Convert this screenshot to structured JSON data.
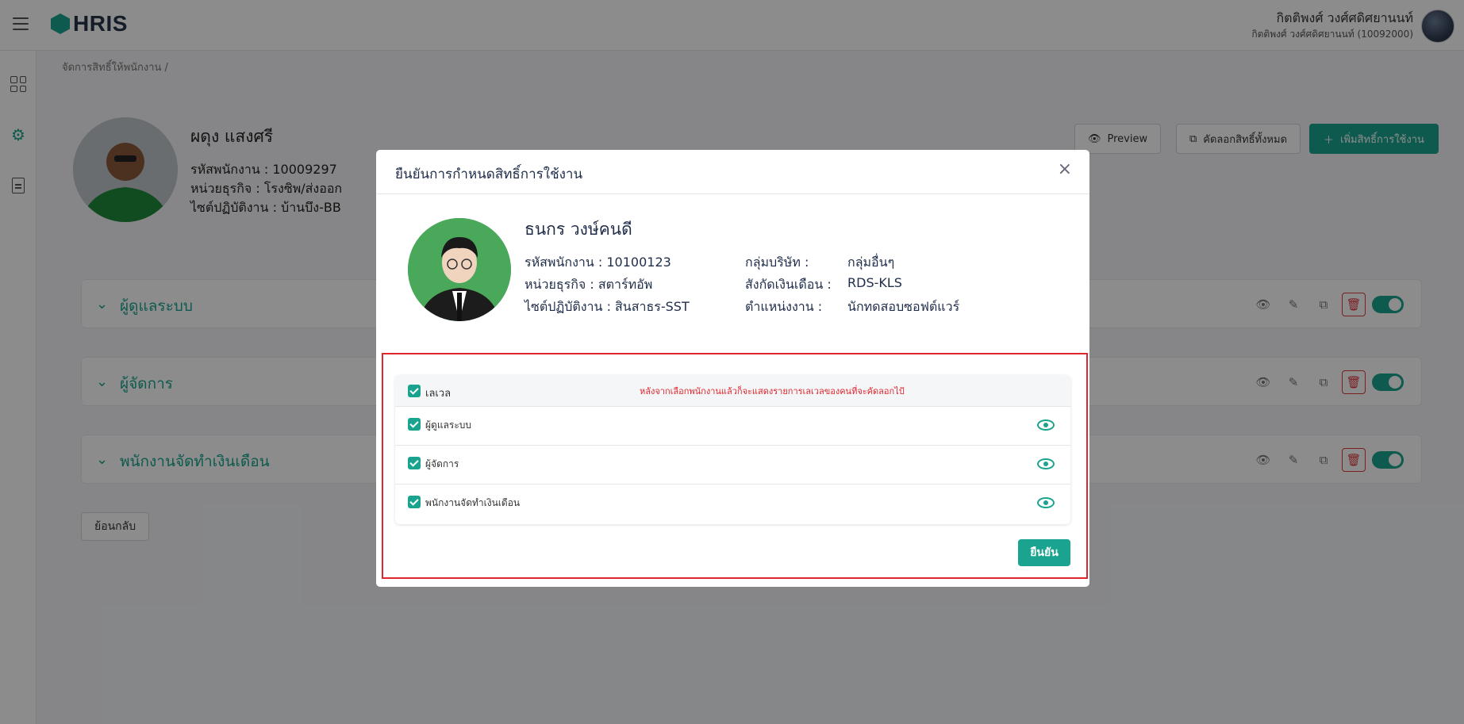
{
  "app": {
    "logo_text": "HRIS"
  },
  "user": {
    "name": "กิตติพงศ์ วงศ์ศดิศยานนท์",
    "sub": "กิตติพงศ์ วงศ์ศดิศยานนท์ (10092000)"
  },
  "breadcrumb": "จัดการสิทธิ์ให้พนักงาน /",
  "profile": {
    "name": "ผดุง แสงศรี",
    "employee_id": "รหัสพนักงาน : 10009297",
    "business_unit": "หน่วยธุรกิจ : โรงซิพ/ส่งออก",
    "work_site": "ไซต์ปฏิบัติงาน : บ้านบึง-BB"
  },
  "toolbar": {
    "preview": "Preview",
    "copy_all": "คัดลอกสิทธิ์ทั้งหมด",
    "add_permission": "เพิ่มสิทธิ์การใช้งาน"
  },
  "roles": [
    {
      "label": "ผู้ดูแลระบบ",
      "enabled": true
    },
    {
      "label": "ผู้จัดการ",
      "enabled": true
    },
    {
      "label": "พนักงานจัดทำเงินเดือน",
      "enabled": true
    }
  ],
  "back_button": "ย้อนกลับ",
  "modal": {
    "title": "ยืนยันการกำหนดสิทธิ์การใช้งาน",
    "close_icon": "×",
    "employee": {
      "name": "ธนกร วงษ์คนดี",
      "employee_id": "รหัสพนักงาน : 10100123",
      "business_unit": "หน่วยธุรกิจ : สตาร์ทอัพ",
      "work_site": "ไซต์ปฏิบัติงาน : สินสาธร-SST",
      "company_group_label": "กลุ่มบริษัท :",
      "company_group_value": "กลุ่มอื่นๆ",
      "payroll_label": "สังกัดเงินเดือน :",
      "payroll_value": "RDS-KLS",
      "position_label": "ตำแหน่งงาน :",
      "position_value": "นักทดสอบซอฟต์แวร์"
    },
    "table": {
      "header_label": "เลเวล",
      "note": "หลังจากเลือกพนักงานแล้วก็จะแสดงรายการเลเวลของคนที่จะคัดลอกไป้",
      "rows": [
        {
          "label": "ผู้ดูแลระบบ",
          "checked": true
        },
        {
          "label": "ผู้จัดการ",
          "checked": true
        },
        {
          "label": "พนักงานจัดทำเงินเดือน",
          "checked": true
        }
      ]
    },
    "confirm": "ยืนยัน"
  },
  "colors": {
    "accent": "#1aa48f",
    "danger": "#e0252b",
    "title": "#1f2d4a"
  },
  "icons": [
    "menu-icon",
    "grid-icon",
    "gear-icon",
    "document-icon",
    "eye-icon",
    "copy-icon",
    "plus-icon",
    "chevron-down-icon",
    "edit-icon",
    "trash-icon",
    "close-icon",
    "check-icon"
  ]
}
